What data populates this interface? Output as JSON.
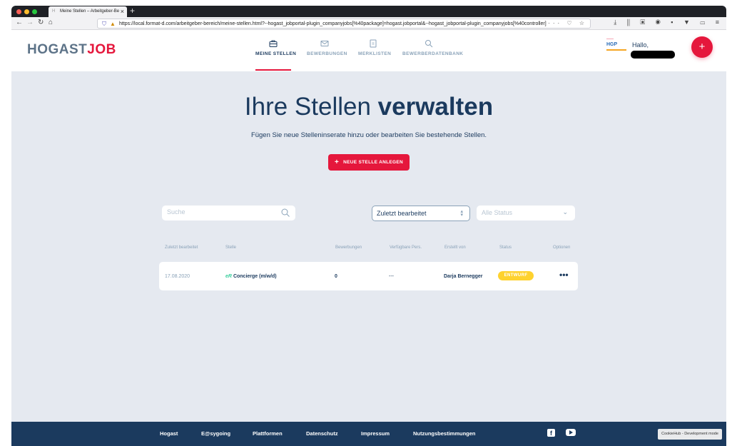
{
  "browser": {
    "tab_title": "Meine Stellen – Arbeitgeber-Be",
    "url": "https://local.format-d.com/arbeitgeber-bereich/meine-stellen.html?--hogast_jobportal-plugin_companyjobs[%40package]=hogast.jobportal&--hogast_jobportal-plugin_companyjobs[%40controller]",
    "url_tools": "··· ♡ ☆",
    "toolbar_icons": "⤓ ⫼ ▣ ◉ ▪ ▼ ▭ ≡",
    "traffic_colors": [
      "#ff5f57",
      "#febc2e",
      "#28c840"
    ]
  },
  "header": {
    "logo_left": "HOGAST",
    "logo_right": "JOB",
    "nav": [
      {
        "label": "MEINE STELLEN",
        "icon": "briefcase-icon",
        "active": true
      },
      {
        "label": "BEWERBUNGEN",
        "icon": "envelope-icon",
        "active": false
      },
      {
        "label": "MERKLISTEN",
        "icon": "bookmark-list-icon",
        "active": false
      },
      {
        "label": "BEWERBERDATENBANK",
        "icon": "search-icon",
        "active": false
      }
    ],
    "company_logo_text": "HGP",
    "greeting": "Hallo,",
    "fab_label": "+"
  },
  "hero": {
    "title_light": "Ihre Stellen ",
    "title_bold": "verwalten",
    "subtitle": "Fügen Sie neue Stelleninserate hinzu oder bearbeiten Sie bestehende Stellen.",
    "cta_label": "NEUE STELLE ANLEGEN"
  },
  "filters": {
    "search_placeholder": "Suche",
    "sort_value": "Zuletzt bearbeitet",
    "status_placeholder": "Alle Status"
  },
  "table": {
    "headers": [
      "Zuletzt bearbeitet",
      "Stelle",
      "Bewerbungen",
      "Verfügbare Pers.",
      "Erstellt von",
      "Status",
      "Optionen"
    ],
    "rows": [
      {
        "date": "17.08.2020",
        "brand": "eR",
        "title": "Concierge (m/w/d)",
        "applications": "0",
        "available": "---",
        "created_by": "Darja Bernegger",
        "status": "ENTWURF",
        "options": "•••"
      }
    ]
  },
  "footer": {
    "links": [
      "Hogast",
      "E@sygoing",
      "Plattformen",
      "Datenschutz",
      "Impressum",
      "Nutzungsbestimmungen"
    ],
    "facebook": "f",
    "cookie_notice": "CookieHub - Development mode"
  },
  "colors": {
    "brand_red": "#e5173c",
    "navy": "#1b3a5e",
    "page_bg": "#e5e9f0",
    "status_draft": "#fed22f"
  }
}
